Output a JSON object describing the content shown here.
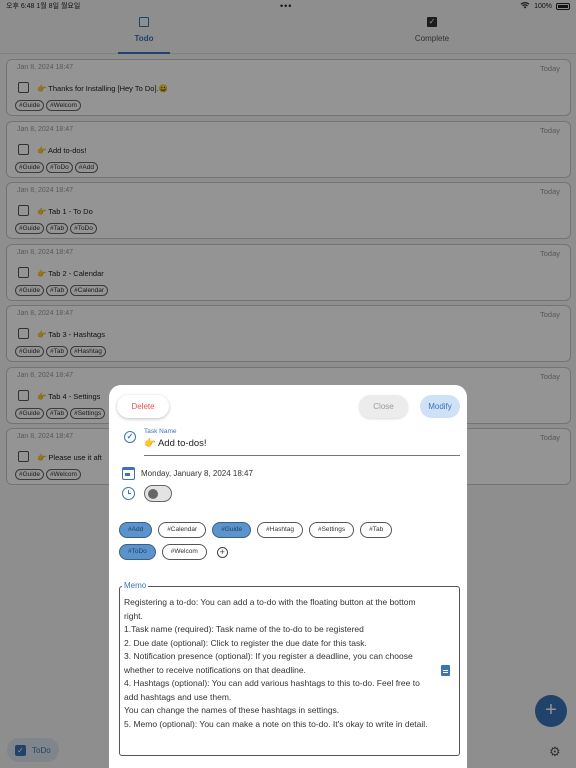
{
  "status_bar": {
    "time_date": "오후 6:48   1월 8일 월요일",
    "dots": "•••",
    "battery_text": "100%"
  },
  "tabs": [
    {
      "label": "Todo",
      "active": true
    },
    {
      "label": "Complete",
      "active": false
    }
  ],
  "todos": [
    {
      "date": "Jan 8, 2024 18:47",
      "today": "Today",
      "title": "👉 Thanks for Installing [Hey To Do].😀",
      "tags": [
        "#Guide",
        "#Welcom"
      ]
    },
    {
      "date": "Jan 8, 2024 18:47",
      "today": "Today",
      "title": "👉 Add to-dos!",
      "tags": [
        "#Guide",
        "#ToDo",
        "#Add"
      ]
    },
    {
      "date": "Jan 8, 2024 18:47",
      "today": "Today",
      "title": "👉 Tab 1 - To Do",
      "tags": [
        "#Guide",
        "#Tab",
        "#ToDo"
      ]
    },
    {
      "date": "Jan 8, 2024 18:47",
      "today": "Today",
      "title": "👉 Tab 2 - Calendar",
      "tags": [
        "#Guide",
        "#Tab",
        "#Calendar"
      ]
    },
    {
      "date": "Jan 8, 2024 18:47",
      "today": "Today",
      "title": "👉 Tab 3 - Hashtags",
      "tags": [
        "#Guide",
        "#Tab",
        "#Hashtag"
      ]
    },
    {
      "date": "Jan 8, 2024 18:47",
      "today": "Today",
      "title": "👉 Tab 4 - Settings",
      "tags": [
        "#Guide",
        "#Tab",
        "#Settings"
      ]
    },
    {
      "date": "Jan 8, 2024 18:47",
      "today": "Today",
      "title": "👉 Please use it aft",
      "tags": [
        "#Guide",
        "#Welcom"
      ]
    }
  ],
  "bottom_bar": {
    "chip_label": "ToDo"
  },
  "modal": {
    "delete_label": "Delete",
    "close_label": "Close",
    "modify_label": "Modify",
    "task_name_label": "Task Name",
    "task_name_value": "👉 Add to-dos!",
    "due_date": "Monday, January 8, 2024   18:47",
    "notification_on": false,
    "tags": [
      {
        "label": "#Add",
        "selected": true
      },
      {
        "label": "#Calendar",
        "selected": false
      },
      {
        "label": "#Guide",
        "selected": true
      },
      {
        "label": "#Hashtag",
        "selected": false
      },
      {
        "label": "#Settings",
        "selected": false
      },
      {
        "label": "#Tab",
        "selected": false
      },
      {
        "label": "#ToDo",
        "selected": true
      },
      {
        "label": "#Welcom",
        "selected": false
      }
    ],
    "memo_label": "Memo",
    "memo_text": "Registering a to-do: You can add a to-do with the floating button at the bottom right.\n1.Task name (required): Task name of the to-do to be registered\n2. Due date (optional): Click to register the due date for this task.\n3. Notification presence (optional): If you register a deadline, you can choose whether to receive notifications on that deadline.\n4. Hashtags (optional): You can add various hashtags to this to-do. Feel free to add hashtags and use them.\nYou can change the names of these hashtags in settings.\n5. Memo (optional): You can make a note on this to-do. It's okay to write in detail."
  },
  "colors": {
    "accent": "#3a73b8",
    "selected_tag": "#5b93cc",
    "delete": "#e25555"
  },
  "icons": [
    "wifi-icon",
    "battery-icon",
    "todo-tab-icon",
    "complete-tab-icon",
    "checkbox-icon",
    "task-check-icon",
    "calendar-icon",
    "alarm-icon",
    "add-tag-icon",
    "document-icon",
    "settings-gear-icon",
    "add-fab-icon"
  ]
}
